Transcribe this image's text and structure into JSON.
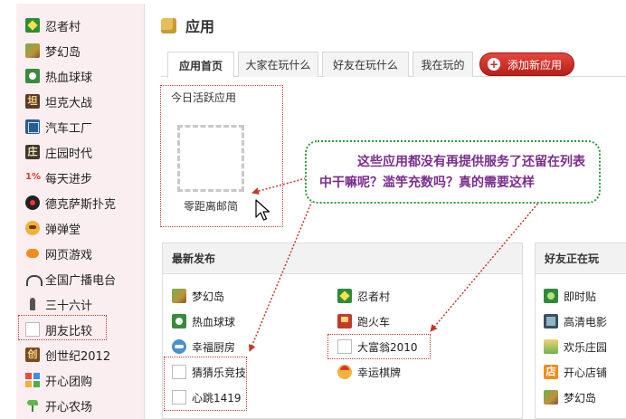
{
  "sidebar": {
    "items": [
      {
        "label": "忍者村",
        "icon": "ninja-icon"
      },
      {
        "label": "梦幻岛",
        "icon": "dream-island-icon"
      },
      {
        "label": "热血球球",
        "icon": "soccer-icon"
      },
      {
        "label": "坦克大战",
        "icon": "tank-icon"
      },
      {
        "label": "汽车工厂",
        "icon": "car-factory-icon"
      },
      {
        "label": "庄园时代",
        "icon": "manor-icon"
      },
      {
        "label": "每天进步",
        "icon": "percent-icon",
        "icon_text": "1%"
      },
      {
        "label": "德克萨斯扑克",
        "icon": "poker-icon"
      },
      {
        "label": "弹弹堂",
        "icon": "bomb-icon"
      },
      {
        "label": "网页游戏",
        "icon": "gamepad-icon"
      },
      {
        "label": "全国广播电台",
        "icon": "radio-icon"
      },
      {
        "label": "三十六计",
        "icon": "chess-icon"
      },
      {
        "label": "朋友比较",
        "icon": "broken-image-icon"
      },
      {
        "label": "创世纪2012",
        "icon": "century-icon"
      },
      {
        "label": "开心团购",
        "icon": "group-buy-icon"
      },
      {
        "label": "开心农场",
        "icon": "farm-icon"
      }
    ]
  },
  "header": {
    "title": "应用"
  },
  "tabs": [
    {
      "label": "应用首页",
      "active": true
    },
    {
      "label": "大家在玩什么",
      "active": false
    },
    {
      "label": "好友在玩什么",
      "active": false
    },
    {
      "label": "我在玩的",
      "active": false
    }
  ],
  "add_button": {
    "label": "添加新应用"
  },
  "today": {
    "title": "今日活跃应用",
    "app_label": "零距离邮简"
  },
  "annotation": {
    "text": "这些应用都没有再提供服务了还留在列表中干嘛呢？滥竽充数吗？真的需要这样"
  },
  "latest": {
    "title": "最新发布",
    "col1": [
      {
        "label": "梦幻岛",
        "icon": "dream-island-icon"
      },
      {
        "label": "热血球球",
        "icon": "soccer-icon"
      },
      {
        "label": "幸福厨房",
        "icon": "kitchen-icon"
      },
      {
        "label": "猜猜乐竞技",
        "icon": "broken-image-icon"
      },
      {
        "label": "心跳1419",
        "icon": "broken-image-icon"
      }
    ],
    "col2": [
      {
        "label": "忍者村",
        "icon": "ninja-icon"
      },
      {
        "label": "跑火车",
        "icon": "train-icon"
      },
      {
        "label": "大富翁2010",
        "icon": "broken-image-icon"
      },
      {
        "label": "幸运棋牌",
        "icon": "face-icon"
      }
    ]
  },
  "friends": {
    "title": "好友正在玩",
    "items": [
      {
        "label": "即时贴",
        "icon": "sticky-note-icon"
      },
      {
        "label": "高清电影",
        "icon": "film-icon"
      },
      {
        "label": "欢乐庄园",
        "icon": "farmland-icon"
      },
      {
        "label": "开心店铺",
        "icon": "shop-icon",
        "icon_text": "店"
      },
      {
        "label": "梦幻岛",
        "icon": "dream-island-icon"
      }
    ]
  },
  "colors": {
    "sidebar_bg": "#fbeef0",
    "accent_red": "#c0392b",
    "annotation_green": "#2e9a3e",
    "annotation_text": "#7b2d8e"
  }
}
